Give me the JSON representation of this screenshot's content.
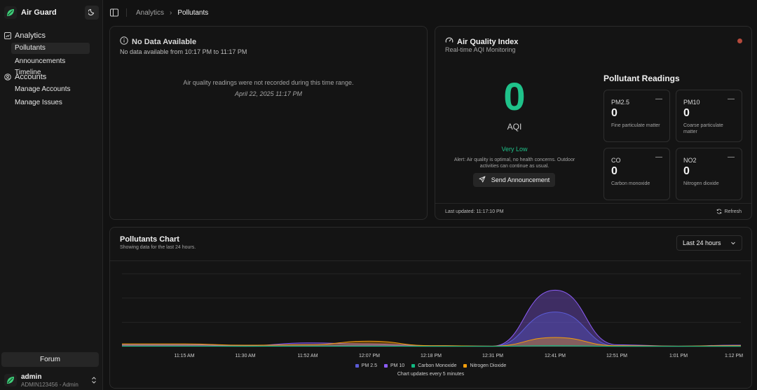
{
  "app": {
    "name": "Air Guard",
    "accent": "#1fc28a"
  },
  "sidebar": {
    "groups": [
      {
        "label": "Analytics",
        "icon": "chart-icon",
        "items": [
          {
            "label": "Pollutants",
            "active": true
          },
          {
            "label": "Announcements Timeline",
            "active": false
          }
        ]
      },
      {
        "label": "Accounts",
        "icon": "users-icon",
        "items": [
          {
            "label": "Manage Accounts",
            "active": false
          },
          {
            "label": "Manage Issues",
            "active": false
          }
        ]
      }
    ],
    "forum_label": "Forum",
    "user": {
      "name": "admin",
      "sub": "ADMIN123456 - Admin"
    }
  },
  "breadcrumb": {
    "parent": "Analytics",
    "current": "Pollutants"
  },
  "no_data": {
    "title": "No Data Available",
    "subtitle": "No data available from 10:17 PM to 11:17 PM",
    "message": "Air quality readings were not recorded during this time range.",
    "date": "April 22, 2025 11:17 PM"
  },
  "aqi": {
    "title": "Air Quality Index",
    "subtitle": "Real-time AQI Monitoring",
    "value": "0",
    "label": "AQI",
    "level": "Very Low",
    "alert": "Alert: Air quality is optimal, no health concerns. Outdoor activities can continue as usual.",
    "send_label": "Send Announcement",
    "readings_title": "Pollutant Readings",
    "readings": [
      {
        "name": "PM2.5",
        "value": "0",
        "desc": "Fine particulate matter",
        "trend": "—"
      },
      {
        "name": "PM10",
        "value": "0",
        "desc": "Coarse particulate matter",
        "trend": "—"
      },
      {
        "name": "CO",
        "value": "0",
        "desc": "Carbon monoxide",
        "trend": "—"
      },
      {
        "name": "NO2",
        "value": "0",
        "desc": "Nitrogen dioxide",
        "trend": "—"
      }
    ],
    "last_updated": "Last updated: 11:17:10 PM",
    "refresh_label": "Refresh",
    "status_color": "#b54a3c"
  },
  "chart": {
    "title": "Pollutants Chart",
    "subtitle": "Showing data for the last 24 hours.",
    "range_label": "Last 24 hours",
    "note": "Chart updates every 5 minutes"
  },
  "chart_data": {
    "type": "area",
    "x": [
      "11:15 AM",
      "11:30 AM",
      "11:52 AM",
      "12:07 PM",
      "12:18 PM",
      "12:31 PM",
      "12:41 PM",
      "12:51 PM",
      "1:01 PM",
      "1:12 PM"
    ],
    "series": [
      {
        "name": "PM 2.5",
        "color": "#5b5bd6",
        "values": [
          1,
          0.5,
          0.8,
          1.5,
          0.5,
          0.3,
          38,
          0.5,
          0.3,
          1
        ]
      },
      {
        "name": "PM 10",
        "color": "#8b5cf6",
        "values": [
          2,
          1,
          4,
          3,
          1,
          0.5,
          62,
          2,
          0.5,
          1.5
        ]
      },
      {
        "name": "Carbon Monoxide",
        "color": "#10b981",
        "values": [
          0.5,
          0.3,
          0.5,
          0.5,
          0.3,
          0.3,
          1,
          0.3,
          0.3,
          0.3
        ]
      },
      {
        "name": "Nitrogen Dioxide",
        "color": "#f59e0b",
        "values": [
          3,
          1.5,
          2,
          6,
          1,
          0.5,
          10,
          1,
          0.5,
          1
        ]
      }
    ],
    "ylim": [
      0,
      80
    ],
    "grid": true,
    "legend": "bottom"
  }
}
